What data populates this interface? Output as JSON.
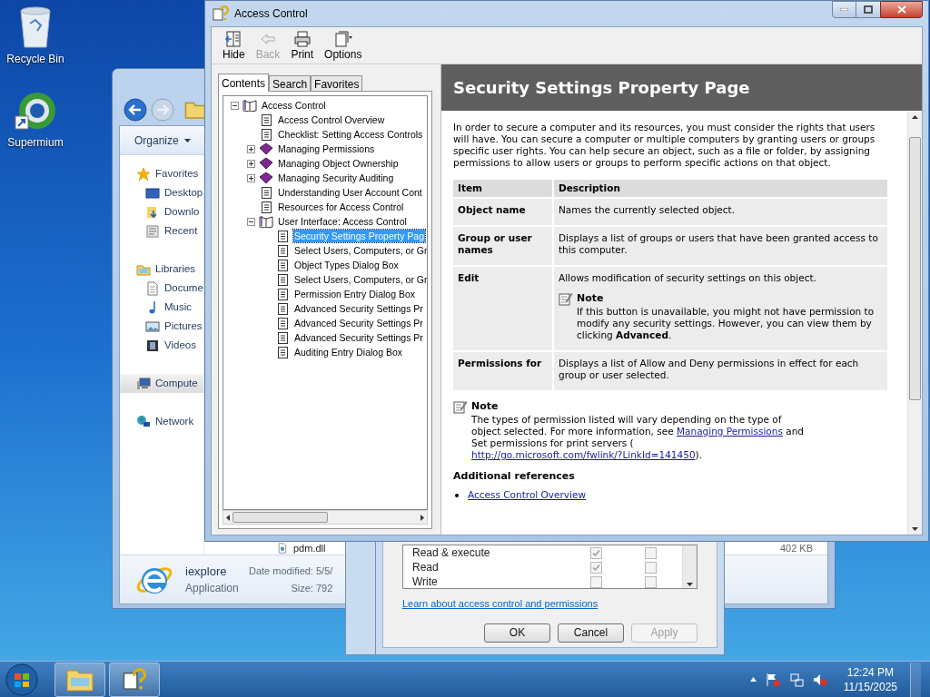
{
  "desktop_icons": [
    {
      "label": "Recycle Bin",
      "kind": "bin"
    },
    {
      "label": "Supermium",
      "kind": "shortcut"
    }
  ],
  "explorer": {
    "organize": "Organize",
    "nav": [
      {
        "label": "Favorites",
        "kind": "star",
        "selected": false,
        "children": [
          {
            "label": "Desktop",
            "kind": "desktop",
            "selected": false
          },
          {
            "label": "Downlo",
            "kind": "download",
            "selected": false
          },
          {
            "label": "Recent",
            "kind": "recent",
            "selected": false
          }
        ]
      },
      {
        "label": "Libraries",
        "kind": "library",
        "selected": false,
        "children": [
          {
            "label": "Docume",
            "kind": "document",
            "selected": false
          },
          {
            "label": "Music",
            "kind": "music",
            "selected": false
          },
          {
            "label": "Pictures",
            "kind": "picture",
            "selected": false
          },
          {
            "label": "Videos",
            "kind": "video",
            "selected": false
          }
        ]
      },
      {
        "label": "Compute",
        "kind": "computer",
        "selected": true
      },
      {
        "label": "Network",
        "kind": "network",
        "selected": false
      }
    ],
    "file_row": {
      "name": "pdm.dll",
      "size": "402 KB"
    },
    "details": {
      "name": "iexplore",
      "type": "Application",
      "date": "Date modified: 5/5/",
      "size": "Size: 792"
    }
  },
  "help": {
    "title": "Access Control",
    "toolbar": [
      {
        "label": "Hide",
        "kind": "hide",
        "disabled": false
      },
      {
        "label": "Back",
        "kind": "back",
        "disabled": true
      },
      {
        "label": "Print",
        "kind": "print",
        "disabled": false
      },
      {
        "label": "Options",
        "kind": "options",
        "disabled": false
      }
    ],
    "tabs": [
      {
        "label": "Contents",
        "selected": true
      },
      {
        "label": "Search",
        "selected": false
      },
      {
        "label": "Favorites",
        "selected": false
      }
    ],
    "tree": [
      {
        "label": "Access Control",
        "kind": "book",
        "expanded": true,
        "selected": false,
        "children": [
          {
            "label": "Access Control Overview",
            "kind": "page",
            "selected": false
          },
          {
            "label": "Checklist: Setting Access Controls",
            "kind": "page",
            "selected": false
          },
          {
            "label": "Managing Permissions",
            "kind": "book",
            "expanded": false,
            "selected": false
          },
          {
            "label": "Managing Object Ownership",
            "kind": "book",
            "expanded": false,
            "selected": false
          },
          {
            "label": "Managing Security Auditing",
            "kind": "book",
            "expanded": false,
            "selected": false
          },
          {
            "label": "Understanding User Account Cont",
            "kind": "page",
            "selected": false
          },
          {
            "label": "Resources for Access Control",
            "kind": "page",
            "selected": false
          },
          {
            "label": "User Interface: Access Control",
            "kind": "book",
            "expanded": true,
            "selected": false,
            "children": [
              {
                "label": "Security Settings Property Pag",
                "kind": "page",
                "selected": true
              },
              {
                "label": "Select Users, Computers, or Gr",
                "kind": "page",
                "selected": false
              },
              {
                "label": "Object Types Dialog Box",
                "kind": "page",
                "selected": false
              },
              {
                "label": "Select Users, Computers, or Gr",
                "kind": "page",
                "selected": false
              },
              {
                "label": "Permission Entry Dialog Box",
                "kind": "page",
                "selected": false
              },
              {
                "label": "Advanced Security Settings Pr",
                "kind": "page",
                "selected": false
              },
              {
                "label": "Advanced Security Settings Pr",
                "kind": "page",
                "selected": false
              },
              {
                "label": "Advanced Security Settings Pr",
                "kind": "page",
                "selected": false
              },
              {
                "label": "Auditing Entry Dialog Box",
                "kind": "page",
                "selected": false
              }
            ]
          }
        ]
      }
    ],
    "page": {
      "title": "Security Settings Property Page",
      "intro": "In order to secure a computer and its resources, you must consider the rights that users will have. You can secure a computer or multiple computers by granting users or groups specific user rights. You can help secure an object, such as a file or folder, by assigning permissions to allow users or groups to perform specific actions on that object.",
      "table": {
        "columns": [
          "Item",
          "Description"
        ],
        "rows": [
          {
            "item": "Object name",
            "description": "Names the currently selected object."
          },
          {
            "item": "Group or user names",
            "description": "Displays a list of groups or users that have been granted access to this computer."
          },
          {
            "item": "Edit",
            "description": "Allows modification of security settings on this object.",
            "note": {
              "title": "Note",
              "text": "If this button is unavailable, you might not have permission to modify any security settings. However, you can view them by clicking **Advanced**."
            }
          },
          {
            "item": "Permissions for",
            "description": "Displays a list of Allow and Deny permissions in effect for each group or user selected."
          }
        ]
      },
      "note": {
        "title": "Note",
        "segments": [
          {
            "kind": "text",
            "text": "The types of permission listed will vary depending on the type of object selected. For more information, see"
          },
          {
            "kind": "link",
            "text": "Managing Permissions"
          },
          {
            "kind": "text",
            "text": "and Set permissions for print servers ("
          },
          {
            "kind": "link",
            "text": "http://go.microsoft.com/fwlink/?LinkId=141450"
          },
          {
            "kind": "text",
            "text": ")."
          }
        ]
      },
      "references": {
        "title": "Additional references",
        "links": [
          "Access Control Overview"
        ]
      }
    }
  },
  "permissions": {
    "rows": [
      {
        "name": "Read & execute",
        "allow": true,
        "deny": false
      },
      {
        "name": "Read",
        "allow": true,
        "deny": false
      },
      {
        "name": "Write",
        "allow": false,
        "deny": false
      }
    ],
    "link": "Learn about access control and permissions",
    "buttons": [
      {
        "label": "OK",
        "disabled": false
      },
      {
        "label": "Cancel",
        "disabled": false
      },
      {
        "label": "Apply",
        "disabled": true
      }
    ]
  },
  "taskbar": {
    "pinned": [
      {
        "kind": "explorer"
      },
      {
        "kind": "help"
      }
    ],
    "time": "12:24 PM",
    "date": "11/15/2025"
  }
}
